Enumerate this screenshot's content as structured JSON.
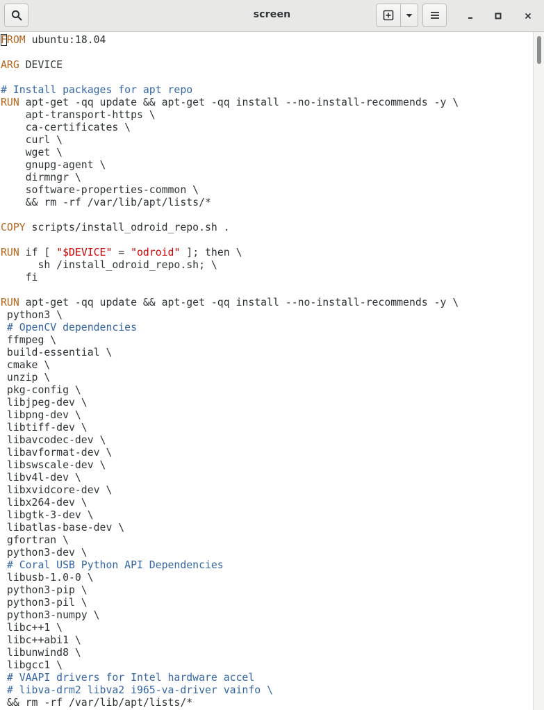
{
  "window": {
    "title": "screen"
  },
  "icons": {
    "search": "magnifier-icon",
    "new_tab": "new-tab-plus-icon",
    "tab_menu": "chevron-down-icon",
    "menu": "hamburger-icon",
    "minimize": "minimize-icon",
    "maximize": "maximize-icon",
    "close": "close-icon"
  },
  "colors": {
    "keyword": "#b5651d",
    "comment": "#3465a4",
    "string": "#cc0000",
    "text": "#2e3436"
  },
  "terminal": {
    "lines": [
      [
        {
          "t": "FROM",
          "c": "kw"
        },
        {
          "t": " ubuntu:18.04"
        }
      ],
      [],
      [
        {
          "t": "ARG",
          "c": "kw"
        },
        {
          "t": " DEVICE"
        }
      ],
      [],
      [
        {
          "t": "# Install packages for apt repo",
          "c": "cm"
        }
      ],
      [
        {
          "t": "RUN",
          "c": "kw"
        },
        {
          "t": " apt-get -qq update && apt-get -qq install --no-install-recommends -y \\"
        }
      ],
      [
        {
          "t": "    apt-transport-https \\"
        }
      ],
      [
        {
          "t": "    ca-certificates \\"
        }
      ],
      [
        {
          "t": "    curl \\"
        }
      ],
      [
        {
          "t": "    wget \\"
        }
      ],
      [
        {
          "t": "    gnupg-agent \\"
        }
      ],
      [
        {
          "t": "    dirmngr \\"
        }
      ],
      [
        {
          "t": "    software-properties-common \\"
        }
      ],
      [
        {
          "t": "    && rm -rf /var/lib/apt/lists/*"
        }
      ],
      [],
      [
        {
          "t": "COPY",
          "c": "kw"
        },
        {
          "t": " scripts/install_odroid_repo.sh ."
        }
      ],
      [],
      [
        {
          "t": "RUN",
          "c": "kw"
        },
        {
          "t": " if [ "
        },
        {
          "t": "\"$DEVICE\"",
          "c": "st"
        },
        {
          "t": " = "
        },
        {
          "t": "\"odroid\"",
          "c": "st"
        },
        {
          "t": " ]; then \\"
        }
      ],
      [
        {
          "t": "      sh /install_odroid_repo.sh; \\"
        }
      ],
      [
        {
          "t": "    fi"
        }
      ],
      [],
      [
        {
          "t": "RUN",
          "c": "kw"
        },
        {
          "t": " apt-get -qq update && apt-get -qq install --no-install-recommends -y \\"
        }
      ],
      [
        {
          "t": " python3 \\"
        }
      ],
      [
        {
          "t": " # OpenCV dependencies",
          "c": "cm"
        }
      ],
      [
        {
          "t": " ffmpeg \\"
        }
      ],
      [
        {
          "t": " build-essential \\"
        }
      ],
      [
        {
          "t": " cmake \\"
        }
      ],
      [
        {
          "t": " unzip \\"
        }
      ],
      [
        {
          "t": " pkg-config \\"
        }
      ],
      [
        {
          "t": " libjpeg-dev \\"
        }
      ],
      [
        {
          "t": " libpng-dev \\"
        }
      ],
      [
        {
          "t": " libtiff-dev \\"
        }
      ],
      [
        {
          "t": " libavcodec-dev \\"
        }
      ],
      [
        {
          "t": " libavformat-dev \\"
        }
      ],
      [
        {
          "t": " libswscale-dev \\"
        }
      ],
      [
        {
          "t": " libv4l-dev \\"
        }
      ],
      [
        {
          "t": " libxvidcore-dev \\"
        }
      ],
      [
        {
          "t": " libx264-dev \\"
        }
      ],
      [
        {
          "t": " libgtk-3-dev \\"
        }
      ],
      [
        {
          "t": " libatlas-base-dev \\"
        }
      ],
      [
        {
          "t": " gfortran \\"
        }
      ],
      [
        {
          "t": " python3-dev \\"
        }
      ],
      [
        {
          "t": " # Coral USB Python API Dependencies",
          "c": "cm"
        }
      ],
      [
        {
          "t": " libusb-1.0-0 \\"
        }
      ],
      [
        {
          "t": " python3-pip \\"
        }
      ],
      [
        {
          "t": " python3-pil \\"
        }
      ],
      [
        {
          "t": " python3-numpy \\"
        }
      ],
      [
        {
          "t": " libc++1 \\"
        }
      ],
      [
        {
          "t": " libc++abi1 \\"
        }
      ],
      [
        {
          "t": " libunwind8 \\"
        }
      ],
      [
        {
          "t": " libgcc1 \\"
        }
      ],
      [
        {
          "t": " # VAAPI drivers for Intel hardware accel",
          "c": "cm"
        }
      ],
      [
        {
          "t": " # libva-drm2 libva2 i965-va-driver vainfo \\",
          "c": "cm"
        }
      ],
      [
        {
          "t": " && rm -rf /var/lib/apt/lists/*"
        }
      ]
    ]
  }
}
